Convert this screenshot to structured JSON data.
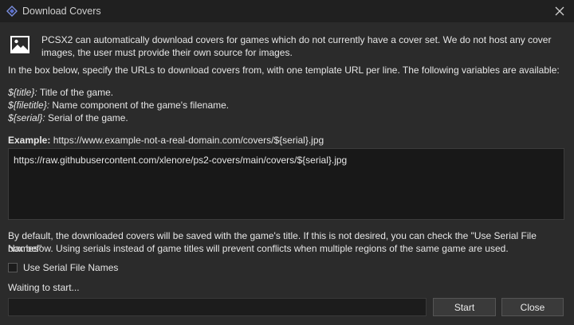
{
  "window": {
    "title": "Download Covers"
  },
  "intro": {
    "text": "PCSX2 can automatically download covers for games which do not currently have a cover set. We do not host any cover images, the user must provide their own source for images."
  },
  "instructions": {
    "text": "In the box below, specify the URLs to download covers from, with one template URL per line. The following variables are available:"
  },
  "variables": [
    {
      "name": "${title}:",
      "desc": " Title of the game."
    },
    {
      "name": "${filetitle}:",
      "desc": " Name component of the game's filename."
    },
    {
      "name": "${serial}:",
      "desc": " Serial of the game."
    }
  ],
  "example": {
    "label": "Example:",
    "value": " https://www.example-not-a-real-domain.com/covers/${serial}.jpg"
  },
  "url_box": {
    "value": "https://raw.githubusercontent.com/xlenore/ps2-covers/main/covers/${serial}.jpg"
  },
  "note": {
    "line1": "By default, the downloaded covers will be saved with the game's title. If this is not desired, you can check the \"Use Serial File Names\"",
    "line2": "box below. Using serials instead of game titles will prevent conflicts when multiple regions of the same game are used."
  },
  "checkbox": {
    "label": "Use Serial File Names",
    "checked": false
  },
  "status": {
    "text": "Waiting to start..."
  },
  "progress": {
    "value": 0
  },
  "buttons": {
    "start": "Start",
    "close": "Close"
  },
  "icons": {
    "app": "pcsx2-app-icon",
    "close": "close-icon",
    "image": "image-icon"
  },
  "colors": {
    "background": "#2b2b2b",
    "titlebar": "#202020",
    "text": "#e6e6e6",
    "input_bg": "#181818"
  }
}
